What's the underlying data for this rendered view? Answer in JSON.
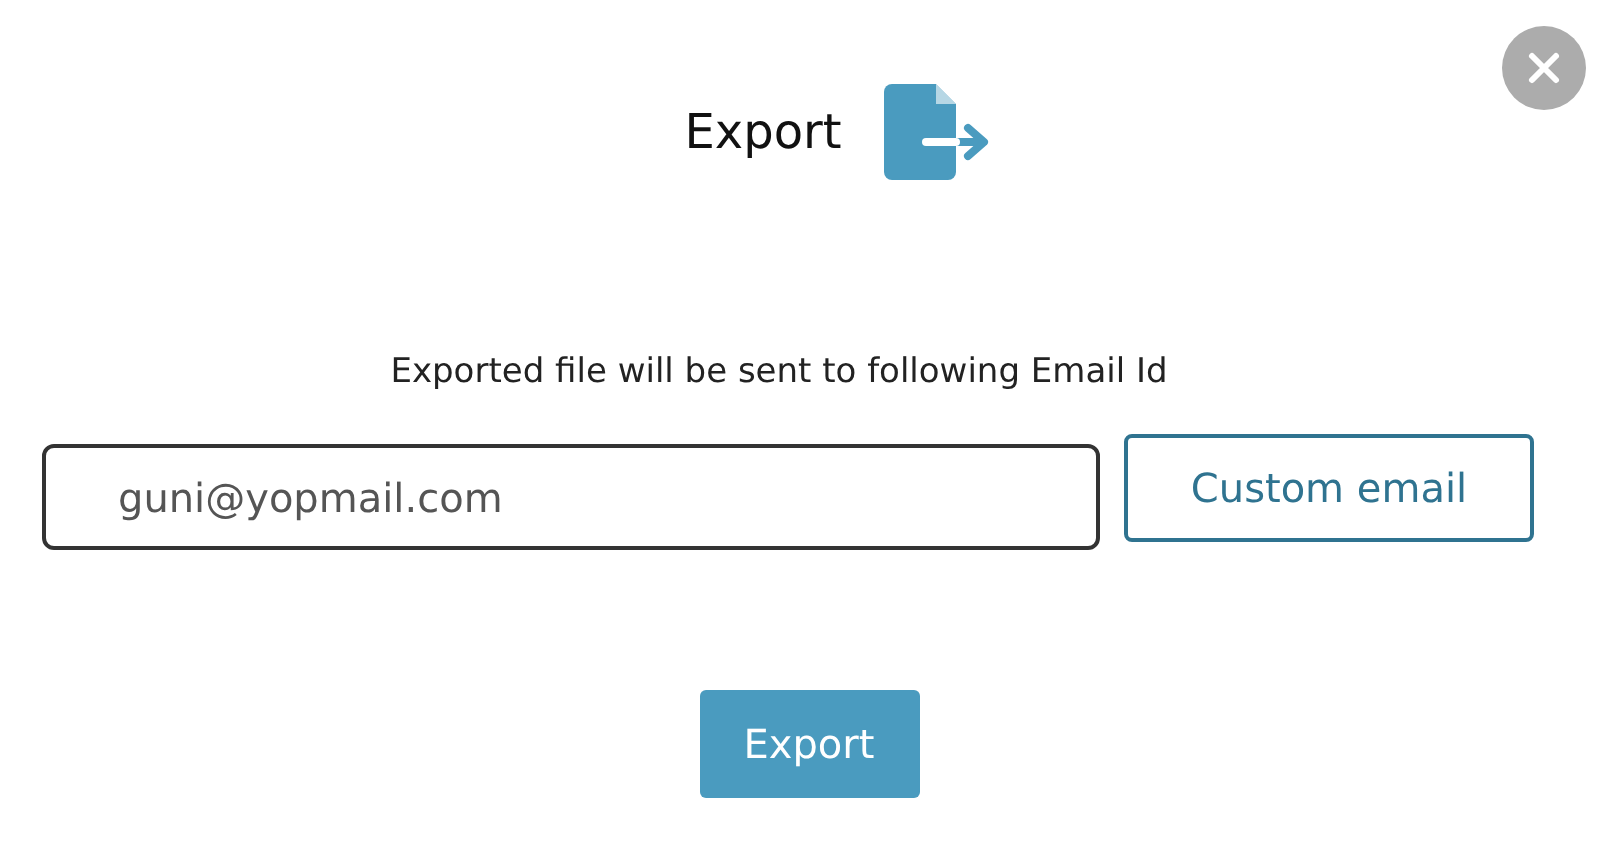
{
  "dialog": {
    "title": "Export",
    "message": "Exported file will be sent to following Email Id",
    "email_field": {
      "value": "guni@yopmail.com"
    },
    "custom_email_button": "Custom email",
    "export_button": "Export"
  }
}
